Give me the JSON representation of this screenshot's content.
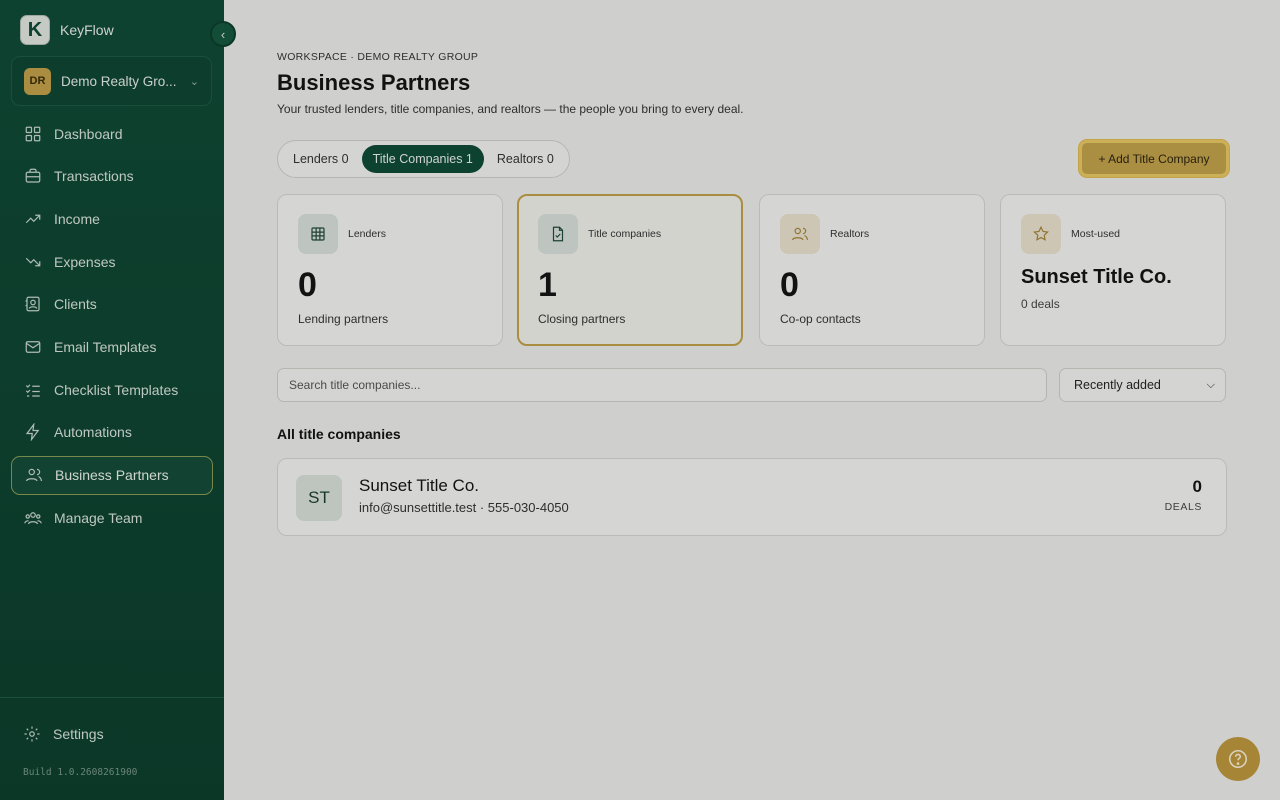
{
  "app": {
    "brand": "KeyFlow",
    "logo_letter": "K"
  },
  "workspace": {
    "initials": "DR",
    "name": "Demo Realty Gro..."
  },
  "sidebar": {
    "items": [
      {
        "label": "Dashboard",
        "icon": "grid-icon"
      },
      {
        "label": "Transactions",
        "icon": "briefcase-icon"
      },
      {
        "label": "Income",
        "icon": "trending-up-icon"
      },
      {
        "label": "Expenses",
        "icon": "trending-down-icon"
      },
      {
        "label": "Clients",
        "icon": "contacts-icon"
      },
      {
        "label": "Email Templates",
        "icon": "mail-icon"
      },
      {
        "label": "Checklist Templates",
        "icon": "checklist-icon"
      },
      {
        "label": "Automations",
        "icon": "bolt-icon"
      },
      {
        "label": "Business Partners",
        "icon": "users-icon",
        "active": true
      },
      {
        "label": "Manage Team",
        "icon": "team-icon"
      }
    ],
    "settings_label": "Settings",
    "build": "Build 1.0.2608261900"
  },
  "page": {
    "eyebrow": "WORKSPACE · DEMO REALTY GROUP",
    "title": "Business Partners",
    "subtitle": "Your trusted lenders, title companies, and realtors — the people you bring to every deal."
  },
  "tabs": [
    {
      "label": "Lenders 0",
      "active": false
    },
    {
      "label": "Title Companies 1",
      "active": true
    },
    {
      "label": "Realtors 0",
      "active": false
    }
  ],
  "add_button": "+ Add Title Company",
  "stats": {
    "lenders": {
      "label": "Lenders",
      "value": "0",
      "caption": "Lending partners"
    },
    "title": {
      "label": "Title companies",
      "value": "1",
      "caption": "Closing partners"
    },
    "realtors": {
      "label": "Realtors",
      "value": "0",
      "caption": "Co-op contacts"
    },
    "most_used": {
      "label": "Most-used",
      "name": "Sunset Title Co.",
      "caption": "0 deals"
    }
  },
  "search": {
    "placeholder": "Search title companies..."
  },
  "sort": {
    "selected": "Recently added"
  },
  "list": {
    "title": "All title companies",
    "rows": [
      {
        "initials": "ST",
        "name": "Sunset Title Co.",
        "meta": "info@sunsettitle.test · 555-030-4050",
        "count": "0",
        "count_label": "DEALS"
      }
    ]
  },
  "colors": {
    "sidebar": "#0e4a36",
    "accent_gold": "#c8a64d",
    "active_tab": "#0e4a36"
  }
}
